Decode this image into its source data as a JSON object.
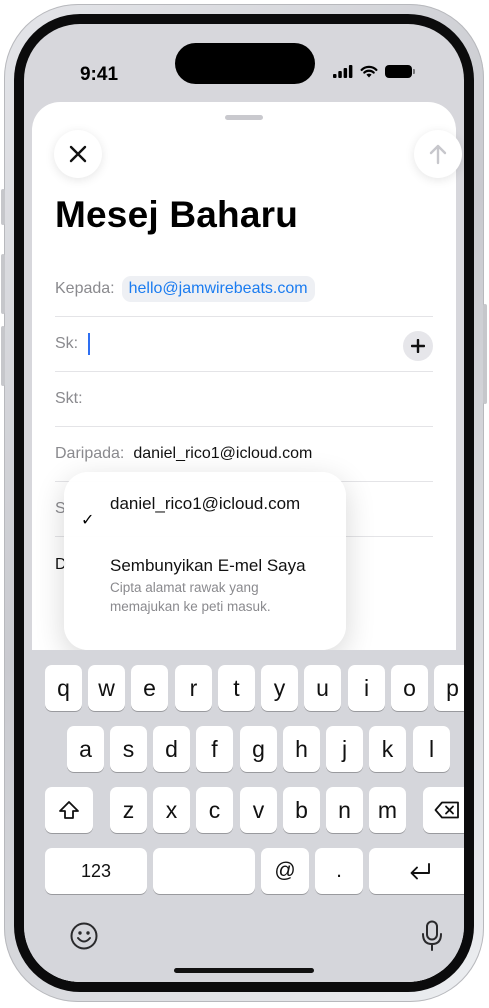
{
  "status": {
    "time": "9:41"
  },
  "compose": {
    "title": "Mesej Baharu",
    "to_label": "Kepada:",
    "to_value": "hello@jamwirebeats.com",
    "cc_label": "Sk:",
    "bcc_label": "Skt:",
    "from_label": "Daripada:",
    "from_value": "daniel_rico1@icloud.com",
    "hidden_row_labels": [
      "S",
      "D"
    ]
  },
  "popup": {
    "check": "✓",
    "option1": "daniel_rico1@icloud.com",
    "option2": "Sembunyikan E-mel Saya",
    "option2_desc": "Cipta alamat rawak yang memajukan ke peti masuk."
  },
  "keyboard": {
    "row1": [
      "q",
      "w",
      "e",
      "r",
      "t",
      "y",
      "u",
      "i",
      "o",
      "p"
    ],
    "row2": [
      "a",
      "s",
      "d",
      "f",
      "g",
      "h",
      "j",
      "k",
      "l"
    ],
    "row3": [
      "z",
      "x",
      "c",
      "v",
      "b",
      "n",
      "m"
    ],
    "numbers_label": "123",
    "at_label": "@",
    "dot_label": "."
  },
  "colors": {
    "accent": "#1b7cf0",
    "cursor": "#2e6ff2"
  },
  "icons": [
    "close-icon",
    "send-arrow-icon",
    "plus-icon",
    "shift-icon",
    "delete-icon",
    "return-icon",
    "emoji-icon",
    "microphone-icon",
    "signal-icon",
    "wifi-icon",
    "battery-icon"
  ]
}
